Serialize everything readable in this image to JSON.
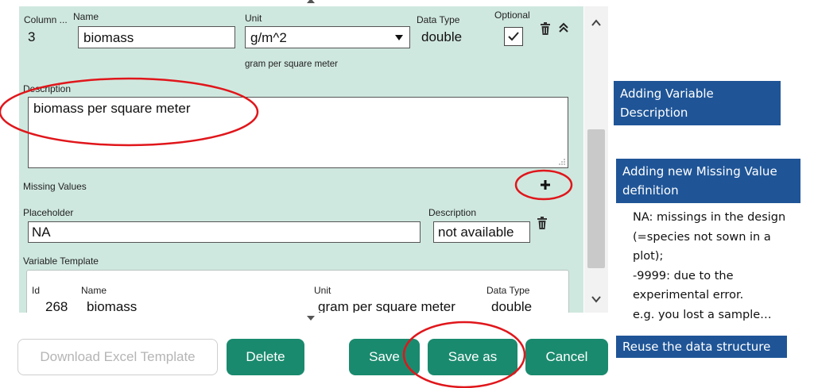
{
  "column": {
    "label": "Column ...",
    "value": "3"
  },
  "name": {
    "label": "Name",
    "value": "biomass"
  },
  "unit": {
    "label": "Unit",
    "value": "g/m^2",
    "description": "gram per square meter"
  },
  "data_type": {
    "label": "Data Type",
    "value": "double"
  },
  "optional": {
    "label": "Optional",
    "checked": true
  },
  "description": {
    "label": "Description",
    "value": "biomass per square meter"
  },
  "missing_values": {
    "label": "Missing Values",
    "placeholder_label": "Placeholder",
    "placeholder_value": "NA",
    "description_label": "Description",
    "description_value": "not available"
  },
  "variable_template": {
    "label": "Variable Template",
    "headers": {
      "id": "Id",
      "name": "Name",
      "unit": "Unit",
      "data_type": "Data Type"
    },
    "row": {
      "id": "268",
      "name": "biomass",
      "unit": "gram per square meter",
      "data_type": "double"
    }
  },
  "buttons": {
    "download": "Download Excel Template",
    "delete": "Delete",
    "save": "Save",
    "save_as": "Save as",
    "cancel": "Cancel"
  },
  "annotations": {
    "callout1": [
      "Adding Variable",
      "Description"
    ],
    "callout2": [
      "Adding new Missing Value",
      "definition"
    ],
    "note": [
      "NA: missings in the design",
      "(=species not sown in a",
      "plot);",
      "-9999: due to the",
      "experimental error.",
      "e.g. you lost a sample…"
    ],
    "callout3": "Reuse the data structure"
  },
  "colors": {
    "panel": "#cfe8df",
    "primary_button": "#1a8a6e",
    "callout": "#1f5597",
    "highlight": "#e0161b"
  }
}
